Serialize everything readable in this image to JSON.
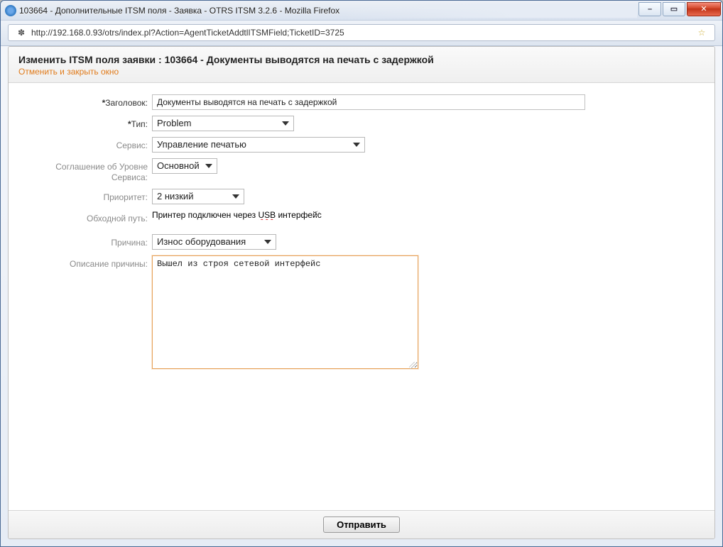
{
  "window": {
    "title": "103664 - Дополнительные ITSM поля - Заявка - OTRS ITSM 3.2.6 - Mozilla Firefox",
    "url": "http://192.168.0.93/otrs/index.pl?Action=AgentTicketAddtlITSMField;TicketID=3725"
  },
  "header": {
    "title": "Изменить ITSM поля заявки : 103664 - Документы выводятся на печать с задержкой",
    "cancel_link": "Отменить и закрыть окно"
  },
  "labels": {
    "title": "Заголовок:",
    "type": "Тип:",
    "service": "Сервис:",
    "sla": "Соглашение об Уровне Сервиса:",
    "priority": "Приоритет:",
    "workaround": "Обходной путь:",
    "reason": "Причина:",
    "reason_desc": "Описание причины:",
    "required_mark": "*"
  },
  "values": {
    "title": "Документы выводятся на печать с задержкой",
    "type": "Problem",
    "service": "Управление печатью",
    "sla": "Основной",
    "priority": "2 низкий",
    "workaround_pre": "Принтер подключен через ",
    "workaround_err": "USB",
    "workaround_post": " интерфейс",
    "reason": "Износ оборудования",
    "reason_desc": "Вышел из строя сетевой интерфейс"
  },
  "footer": {
    "submit": "Отправить"
  }
}
